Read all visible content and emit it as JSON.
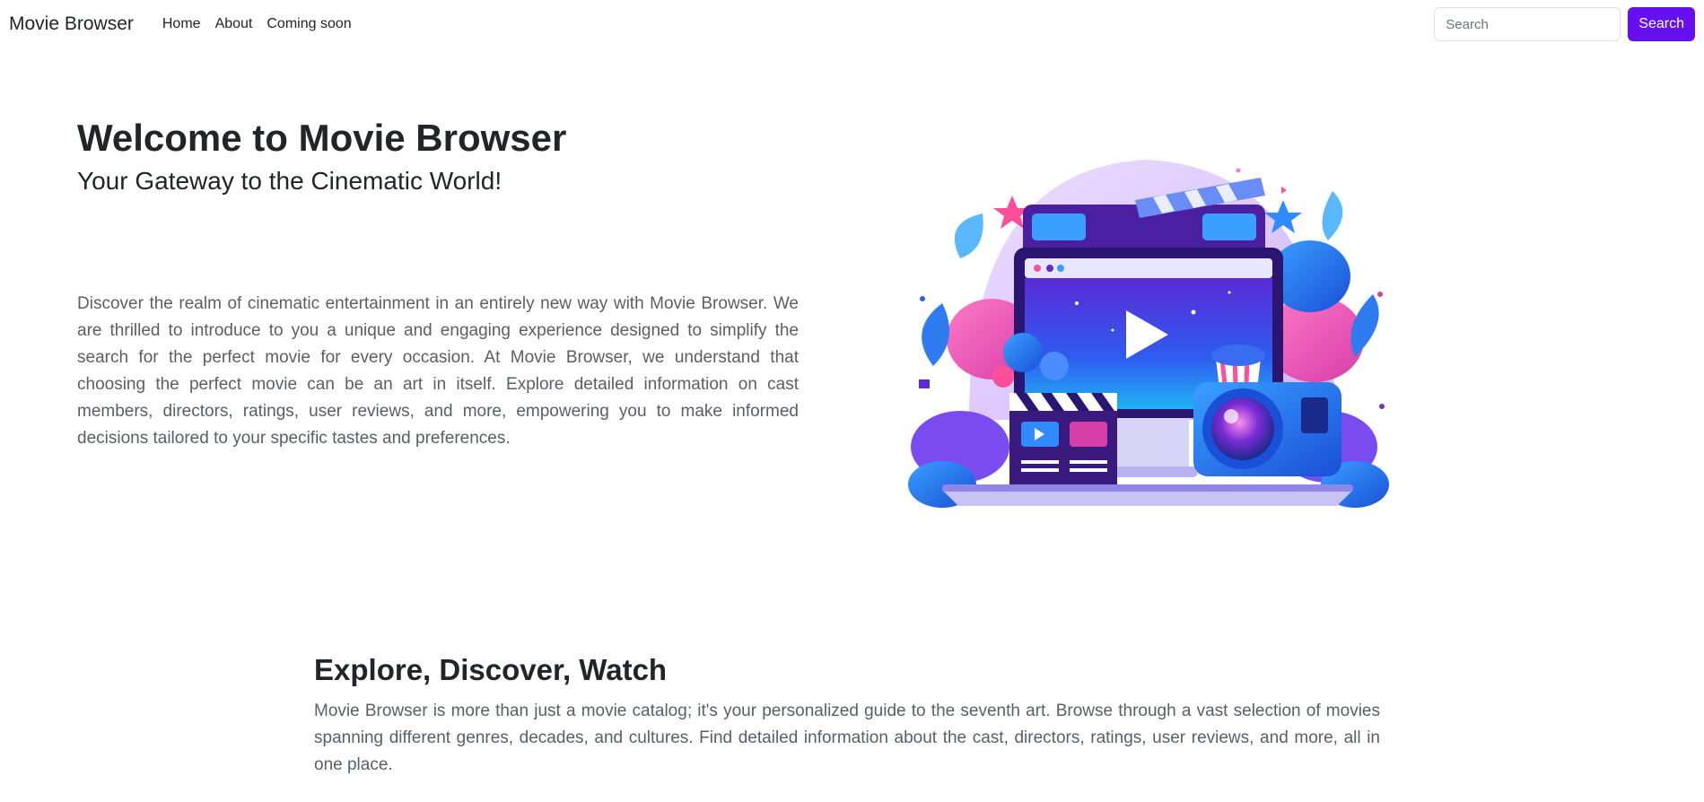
{
  "navbar": {
    "brand": "Movie Browser",
    "links": [
      "Home",
      "About",
      "Coming soon"
    ],
    "search_placeholder": "Search",
    "search_button": "Search"
  },
  "hero": {
    "title": "Welcome to Movie Browser",
    "subtitle": "Your Gateway to the Cinematic World!",
    "text": "Discover the realm of cinematic entertainment in an entirely new way with Movie Browser. We are thrilled to introduce to you a unique and engaging experience designed to simplify the search for the perfect movie for every occasion. At Movie Browser, we understand that choosing the perfect movie can be an art in itself. Explore detailed information on cast members, directors, ratings, user reviews, and more, empowering you to make informed decisions tailored to your specific tastes and preferences.",
    "illustration_icon": "cinema-illustration-icon"
  },
  "section": {
    "title": "Explore, Discover, Watch",
    "text": "Movie Browser is more than just a movie catalog; it's your personalized guide to the seventh art. Browse through a vast selection of movies spanning different genres, decades, and cultures. Find detailed information about the cast, directors, ratings, user reviews, and more, all in one place."
  },
  "colors": {
    "accent": "#6610f2",
    "text": "#212529",
    "muted_text": "#5a5f66"
  }
}
